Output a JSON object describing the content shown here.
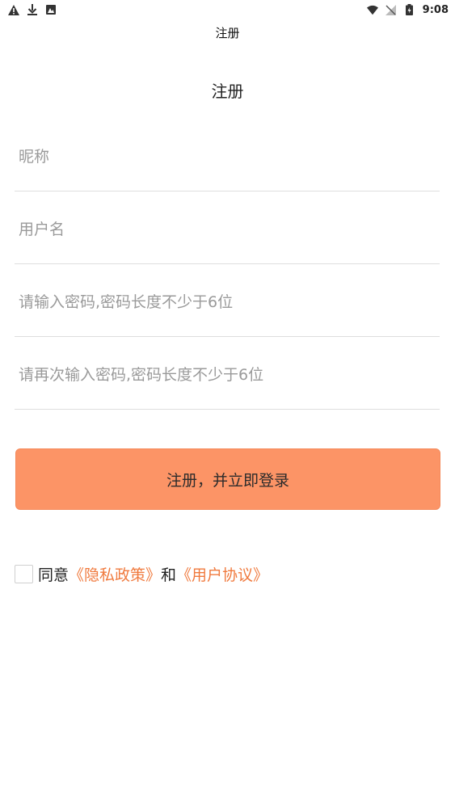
{
  "status_bar": {
    "time": "9:08",
    "left_icons": [
      "warning-icon",
      "download-icon",
      "image-icon"
    ],
    "right_icons": [
      "wifi-icon",
      "no-signal-icon",
      "battery-icon"
    ]
  },
  "app_bar": {
    "title": "注册"
  },
  "page": {
    "title": "注册"
  },
  "form": {
    "nickname_placeholder": "昵称",
    "username_placeholder": "用户名",
    "password_placeholder": "请输入密码,密码长度不少于6位",
    "confirm_placeholder": "请再次输入密码,密码长度不少于6位"
  },
  "submit": {
    "label": "注册，并立即登录"
  },
  "agreement": {
    "prefix": "同意",
    "privacy_link": "《隐私政策》",
    "conjunction": "和",
    "terms_link": "《用户协议》"
  },
  "colors": {
    "accent": "#fc9466",
    "link": "#f07a3e",
    "divider": "#dedede"
  }
}
